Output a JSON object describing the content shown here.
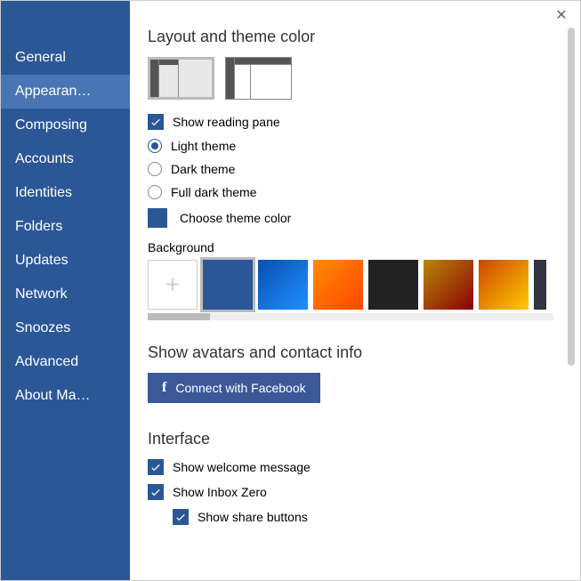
{
  "window": {
    "close_glyph": "✕"
  },
  "sidebar": {
    "items": [
      {
        "label": "General",
        "active": false
      },
      {
        "label": "Appearan…",
        "active": true
      },
      {
        "label": "Composing",
        "active": false
      },
      {
        "label": "Accounts",
        "active": false
      },
      {
        "label": "Identities",
        "active": false
      },
      {
        "label": "Folders",
        "active": false
      },
      {
        "label": "Updates",
        "active": false
      },
      {
        "label": "Network",
        "active": false
      },
      {
        "label": "Snoozes",
        "active": false
      },
      {
        "label": "Advanced",
        "active": false
      },
      {
        "label": "About Ma…",
        "active": false
      }
    ]
  },
  "layout": {
    "title": "Layout and theme color",
    "show_reading_pane": "Show reading pane",
    "radios": {
      "light": "Light theme",
      "dark": "Dark theme",
      "full_dark": "Full dark theme"
    },
    "choose_color": "Choose theme color",
    "background_label": "Background",
    "add_tile_glyph": "+",
    "bg_colors": [
      "#2b5797",
      "linear-gradient(135deg,#0a4fb0,#1e90ff)",
      "linear-gradient(135deg,#ff8c00,#ff4500)",
      "#222",
      "linear-gradient(135deg,#b8860b,#8b0000)",
      "linear-gradient(135deg,#cc4400,#ffcc00)",
      "#333344"
    ],
    "selected_bg_index": 0,
    "theme_color": "#2b5797"
  },
  "avatars": {
    "title": "Show avatars and contact info",
    "fb_label": "Connect with Facebook",
    "fb_icon": "f"
  },
  "interface": {
    "title": "Interface",
    "show_welcome": "Show welcome message",
    "show_inbox_zero": "Show Inbox Zero",
    "show_share_buttons": "Show share buttons"
  }
}
